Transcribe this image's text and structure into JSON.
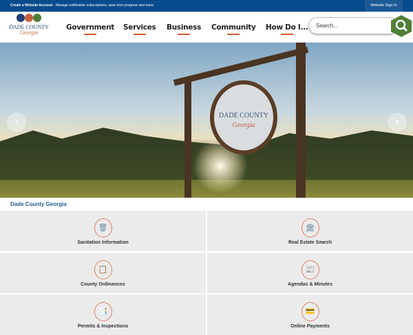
{
  "topbar": {
    "account_link": "Create a Website Account",
    "message": " - Manage notification subscriptions, save form progress and more.",
    "signin": "Website Sign In"
  },
  "logo": {
    "line1": "DADE COUNTY",
    "line2": "Georgia"
  },
  "nav": [
    "Government",
    "Services",
    "Business",
    "Community",
    "How Do I..."
  ],
  "search": {
    "placeholder": "Search..."
  },
  "hero": {
    "sign_text": "DADE COUNTY",
    "sign_script": "Georgia",
    "prev": "‹",
    "next": "›"
  },
  "breadcrumb": "Dade County Georgia",
  "tiles": [
    {
      "label": "Sanitation Information",
      "icon": "🗑"
    },
    {
      "label": "Real Estate Search",
      "icon": "🏛"
    },
    {
      "label": "County Ordinances",
      "icon": "📋"
    },
    {
      "label": "Agendas & Minutes",
      "icon": "📰"
    },
    {
      "label": "Permits & Inspections",
      "icon": "📑"
    },
    {
      "label": "Online Payments",
      "icon": "💳"
    }
  ],
  "colors": {
    "brand_blue": "#064b8c",
    "accent_orange": "#d4572e",
    "search_green": "#4f7f35"
  }
}
